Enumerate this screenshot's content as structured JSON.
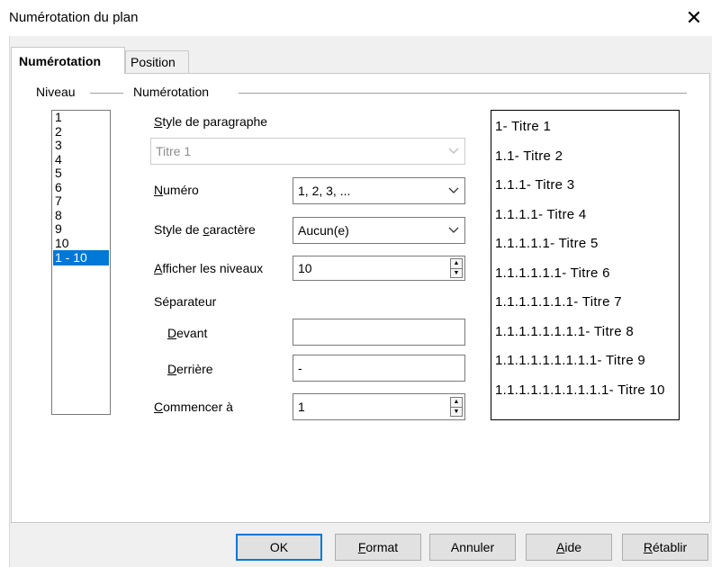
{
  "window": {
    "title": "Numérotation du plan",
    "close_glyph": "✕"
  },
  "tabs": [
    {
      "label": "Numérotation",
      "active": true
    },
    {
      "label": "Position",
      "active": false
    }
  ],
  "level_group": {
    "label": "Niveau",
    "items": [
      "1",
      "2",
      "3",
      "4",
      "5",
      "6",
      "7",
      "8",
      "9",
      "10",
      "1 - 10"
    ],
    "selected": "1 - 10"
  },
  "numbering_group": {
    "label": "Numérotation",
    "paragraph_style": {
      "label": "Style de paragraphe",
      "value": "Titre 1"
    },
    "number": {
      "label": "Numéro",
      "value": "1, 2, 3, ..."
    },
    "char_style": {
      "label": "Style de caractère",
      "value": "Aucun(e)"
    },
    "show_levels": {
      "label": "Afficher les niveaux",
      "value": "10"
    },
    "separator": {
      "label": "Séparateur",
      "before_label": "Devant",
      "before_value": "",
      "after_label": "Derrière",
      "after_value": "-"
    },
    "start_at": {
      "label": "Commencer à",
      "value": "1"
    }
  },
  "preview": {
    "lines": [
      "1- Titre 1",
      "1.1- Titre 2",
      "1.1.1- Titre 3",
      "1.1.1.1- Titre 4",
      "1.1.1.1.1- Titre 5",
      "1.1.1.1.1.1- Titre 6",
      "1.1.1.1.1.1.1- Titre 7",
      "1.1.1.1.1.1.1.1- Titre 8",
      "1.1.1.1.1.1.1.1.1- Titre 9",
      "1.1.1.1.1.1.1.1.1.1- Titre 10"
    ]
  },
  "buttons": {
    "ok": "OK",
    "format": "Format",
    "cancel": "Annuler",
    "help": "Aide",
    "reset": "Rétablir"
  },
  "colors": {
    "selection": "#0078d7",
    "dialog_bg": "#f0f0f0"
  }
}
